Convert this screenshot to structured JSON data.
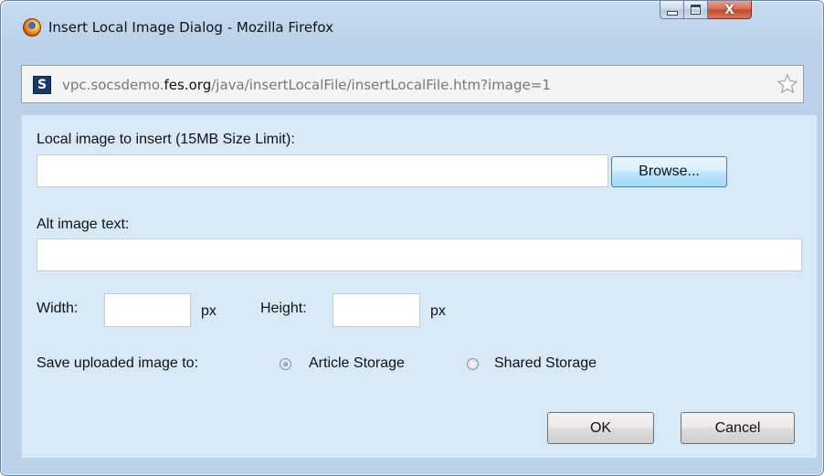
{
  "window": {
    "title": "Insert Local Image Dialog - Mozilla Firefox",
    "buttons": {
      "minimize": "minimize",
      "maximize": "maximize",
      "close": "X"
    }
  },
  "urlbar": {
    "prefix": "vpc.socsdemo.",
    "domain": "fes.org",
    "path": "/java/insertLocalFile/insertLocalFile.htm?image=1",
    "site_icon_letter": "S"
  },
  "form": {
    "file_label": "Local image to insert (15MB Size Limit):",
    "file_value": "",
    "browse_label": "Browse...",
    "alt_label": "Alt image text:",
    "alt_value": "",
    "width_label": "Width:",
    "width_value": "",
    "width_unit": "px",
    "height_label": "Height:",
    "height_value": "",
    "height_unit": "px",
    "save_label": "Save uploaded image to:",
    "storage_options": [
      {
        "label": "Article Storage",
        "selected": true
      },
      {
        "label": "Shared Storage",
        "selected": false
      }
    ]
  },
  "actions": {
    "ok_label": "OK",
    "cancel_label": "Cancel"
  },
  "icons": {
    "app": "firefox-logo-icon",
    "site": "site-favicon-icon",
    "bookmark": "star-icon"
  }
}
